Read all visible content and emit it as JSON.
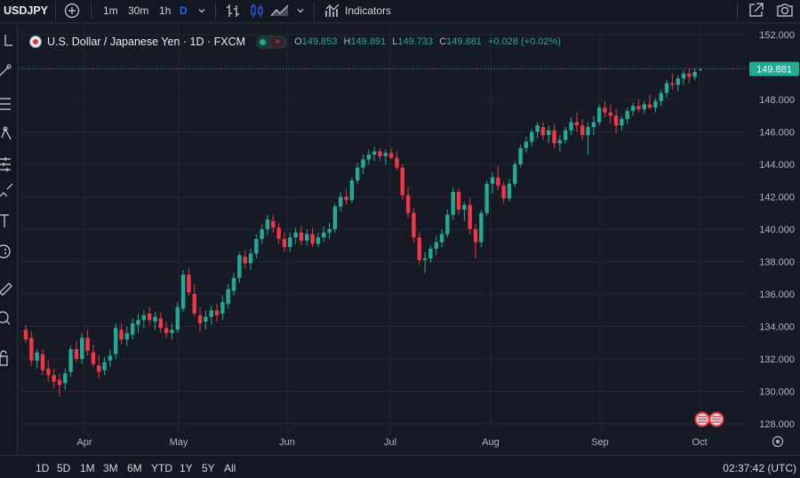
{
  "toolbar": {
    "symbol": "USDJPY",
    "intervals": [
      "1m",
      "30m",
      "1h",
      "D"
    ],
    "indicators_label": "Indicators"
  },
  "legend": {
    "title": "U.S. Dollar / Japanese Yen · 1D · FXCM",
    "wave_glyph": "≈",
    "o_key": "O",
    "o_val": "149.853",
    "h_key": "H",
    "h_val": "149.891",
    "l_key": "L",
    "l_val": "149.733",
    "c_key": "C",
    "c_val": "149.881",
    "change": "+0.028 (+0.02%)"
  },
  "bottom": {
    "ranges": [
      "1D",
      "5D",
      "1M",
      "3M",
      "6M",
      "YTD",
      "1Y",
      "5Y",
      "All"
    ],
    "clock": "02:37:42 (UTC)"
  },
  "colors": {
    "up": "#22ab94",
    "down": "#f23645",
    "price_tag": "#22ab94",
    "background": "#161a25"
  },
  "chart_data": {
    "type": "candlestick",
    "y_ticks": [
      "152.000",
      "150.000",
      "148.000",
      "146.000",
      "144.000",
      "142.000",
      "140.000",
      "138.000",
      "136.000",
      "134.000",
      "132.000",
      "130.000",
      "128.000"
    ],
    "ylim": [
      127.2,
      152.3
    ],
    "x_ticks": [
      "Apr",
      "May",
      "Jun",
      "Jul",
      "Aug",
      "Sep",
      "Oct"
    ],
    "last_price": "149.881",
    "series": [
      {
        "name": "USDJPY",
        "ohlc": [
          [
            133.8,
            134.1,
            133.0,
            133.2
          ],
          [
            133.3,
            133.7,
            131.6,
            131.9
          ],
          [
            131.9,
            132.6,
            131.4,
            132.4
          ],
          [
            132.3,
            132.6,
            131.0,
            131.3
          ],
          [
            131.4,
            131.9,
            130.6,
            131.0
          ],
          [
            131.0,
            131.4,
            130.2,
            130.6
          ],
          [
            130.7,
            131.1,
            129.7,
            130.4
          ],
          [
            130.5,
            131.4,
            130.1,
            131.1
          ],
          [
            131.2,
            132.8,
            130.9,
            132.6
          ],
          [
            132.6,
            133.1,
            131.8,
            132.0
          ],
          [
            132.0,
            133.6,
            131.7,
            133.3
          ],
          [
            133.3,
            133.8,
            132.2,
            132.5
          ],
          [
            132.4,
            132.9,
            131.5,
            131.7
          ],
          [
            131.6,
            132.2,
            130.8,
            131.2
          ],
          [
            131.3,
            132.1,
            131.0,
            131.8
          ],
          [
            131.9,
            132.6,
            131.5,
            132.2
          ],
          [
            132.3,
            134.2,
            132.0,
            133.9
          ],
          [
            133.8,
            134.2,
            132.9,
            133.2
          ],
          [
            133.2,
            134.0,
            132.8,
            133.6
          ],
          [
            133.5,
            134.5,
            133.2,
            134.2
          ],
          [
            134.1,
            134.8,
            133.6,
            134.4
          ],
          [
            134.4,
            135.0,
            133.9,
            134.7
          ],
          [
            134.8,
            135.2,
            134.1,
            134.4
          ],
          [
            134.3,
            134.9,
            133.8,
            134.6
          ],
          [
            134.5,
            134.9,
            133.6,
            133.9
          ],
          [
            133.9,
            134.3,
            133.3,
            133.6
          ],
          [
            133.6,
            134.2,
            133.2,
            133.8
          ],
          [
            133.8,
            135.5,
            133.6,
            135.2
          ],
          [
            135.1,
            137.5,
            134.9,
            137.2
          ],
          [
            137.2,
            137.6,
            135.9,
            136.1
          ],
          [
            136.0,
            136.6,
            134.6,
            134.8
          ],
          [
            134.7,
            135.2,
            133.7,
            134.2
          ],
          [
            134.3,
            135.0,
            133.8,
            134.6
          ],
          [
            134.6,
            135.3,
            134.1,
            135.0
          ],
          [
            135.0,
            135.4,
            134.3,
            134.7
          ],
          [
            134.8,
            135.9,
            134.4,
            135.5
          ],
          [
            135.4,
            136.6,
            135.1,
            136.3
          ],
          [
            136.2,
            137.3,
            135.9,
            137.0
          ],
          [
            137.0,
            138.6,
            136.7,
            138.4
          ],
          [
            138.3,
            138.7,
            137.6,
            137.9
          ],
          [
            137.9,
            138.8,
            137.5,
            138.5
          ],
          [
            138.5,
            139.7,
            138.2,
            139.4
          ],
          [
            139.4,
            140.3,
            139.1,
            140.0
          ],
          [
            140.0,
            140.9,
            139.6,
            140.6
          ],
          [
            140.5,
            140.9,
            139.8,
            140.1
          ],
          [
            140.1,
            140.4,
            139.1,
            139.4
          ],
          [
            139.4,
            139.8,
            138.6,
            138.9
          ],
          [
            138.9,
            139.8,
            138.6,
            139.5
          ],
          [
            139.5,
            140.1,
            139.1,
            139.8
          ],
          [
            139.8,
            140.2,
            139.0,
            139.3
          ],
          [
            139.3,
            140.0,
            139.0,
            139.7
          ],
          [
            139.7,
            140.1,
            138.9,
            139.1
          ],
          [
            139.1,
            139.8,
            138.9,
            139.5
          ],
          [
            139.5,
            140.2,
            139.2,
            139.8
          ],
          [
            139.8,
            140.4,
            139.4,
            140.0
          ],
          [
            140.0,
            141.6,
            139.8,
            141.4
          ],
          [
            141.4,
            142.3,
            141.1,
            142.0
          ],
          [
            142.0,
            142.5,
            141.5,
            141.8
          ],
          [
            141.8,
            143.2,
            141.6,
            143.0
          ],
          [
            143.0,
            144.1,
            142.8,
            143.8
          ],
          [
            143.8,
            144.6,
            143.4,
            144.3
          ],
          [
            144.3,
            144.9,
            144.0,
            144.6
          ],
          [
            144.6,
            145.1,
            144.2,
            144.8
          ],
          [
            144.8,
            145.0,
            144.2,
            144.5
          ],
          [
            144.5,
            144.9,
            144.0,
            144.7
          ],
          [
            144.7,
            145.0,
            144.3,
            144.4
          ],
          [
            144.4,
            144.8,
            143.6,
            143.8
          ],
          [
            143.8,
            144.0,
            141.8,
            142.1
          ],
          [
            142.1,
            142.6,
            140.7,
            141.0
          ],
          [
            141.0,
            141.3,
            139.2,
            139.5
          ],
          [
            139.5,
            139.8,
            137.8,
            138.1
          ],
          [
            138.1,
            138.6,
            137.3,
            138.2
          ],
          [
            138.2,
            139.0,
            137.9,
            138.8
          ],
          [
            138.8,
            139.6,
            138.4,
            139.2
          ],
          [
            139.2,
            140.0,
            138.9,
            139.7
          ],
          [
            139.7,
            141.2,
            139.5,
            140.9
          ],
          [
            140.9,
            142.6,
            140.6,
            142.3
          ],
          [
            142.3,
            142.5,
            140.9,
            141.2
          ],
          [
            141.2,
            141.7,
            140.5,
            141.5
          ],
          [
            141.5,
            141.9,
            139.7,
            140.0
          ],
          [
            140.0,
            140.3,
            138.2,
            139.2
          ],
          [
            139.2,
            141.2,
            138.9,
            141.0
          ],
          [
            141.0,
            143.0,
            140.8,
            142.8
          ],
          [
            142.8,
            143.5,
            142.2,
            143.2
          ],
          [
            143.2,
            143.9,
            142.4,
            142.7
          ],
          [
            142.7,
            142.9,
            141.6,
            141.9
          ],
          [
            141.9,
            143.1,
            141.7,
            142.8
          ],
          [
            142.8,
            144.2,
            142.6,
            144.0
          ],
          [
            144.0,
            145.2,
            143.8,
            145.0
          ],
          [
            145.0,
            145.7,
            144.7,
            145.4
          ],
          [
            145.4,
            146.2,
            145.1,
            146.0
          ],
          [
            146.0,
            146.6,
            145.6,
            146.4
          ],
          [
            146.3,
            146.6,
            145.5,
            145.8
          ],
          [
            145.8,
            146.4,
            145.3,
            146.1
          ],
          [
            146.1,
            146.5,
            145.0,
            145.3
          ],
          [
            145.3,
            145.8,
            144.8,
            145.5
          ],
          [
            145.5,
            146.3,
            145.3,
            146.1
          ],
          [
            146.1,
            146.9,
            145.8,
            146.6
          ],
          [
            146.6,
            147.2,
            146.0,
            146.4
          ],
          [
            146.4,
            146.8,
            145.5,
            145.8
          ],
          [
            145.8,
            146.6,
            144.6,
            146.3
          ],
          [
            146.3,
            147.0,
            145.8,
            146.6
          ],
          [
            146.6,
            147.7,
            146.4,
            147.5
          ],
          [
            147.5,
            147.9,
            146.9,
            147.2
          ],
          [
            147.2,
            147.7,
            146.5,
            147.0
          ],
          [
            147.0,
            147.4,
            145.9,
            146.4
          ],
          [
            146.4,
            147.0,
            146.1,
            146.8
          ],
          [
            146.8,
            147.5,
            146.5,
            147.3
          ],
          [
            147.3,
            147.8,
            147.0,
            147.6
          ],
          [
            147.6,
            148.0,
            147.2,
            147.4
          ],
          [
            147.4,
            147.9,
            147.1,
            147.7
          ],
          [
            147.7,
            148.3,
            147.4,
            147.5
          ],
          [
            147.5,
            148.1,
            147.2,
            147.9
          ],
          [
            147.9,
            148.6,
            147.6,
            148.4
          ],
          [
            148.4,
            149.2,
            148.1,
            149.0
          ],
          [
            149.0,
            149.6,
            148.6,
            148.9
          ],
          [
            148.9,
            149.5,
            148.5,
            149.3
          ],
          [
            149.3,
            149.8,
            148.9,
            149.6
          ],
          [
            149.6,
            149.9,
            149.0,
            149.4
          ],
          [
            149.4,
            149.9,
            149.2,
            149.7
          ],
          [
            149.853,
            149.891,
            149.733,
            149.881
          ]
        ]
      }
    ]
  }
}
